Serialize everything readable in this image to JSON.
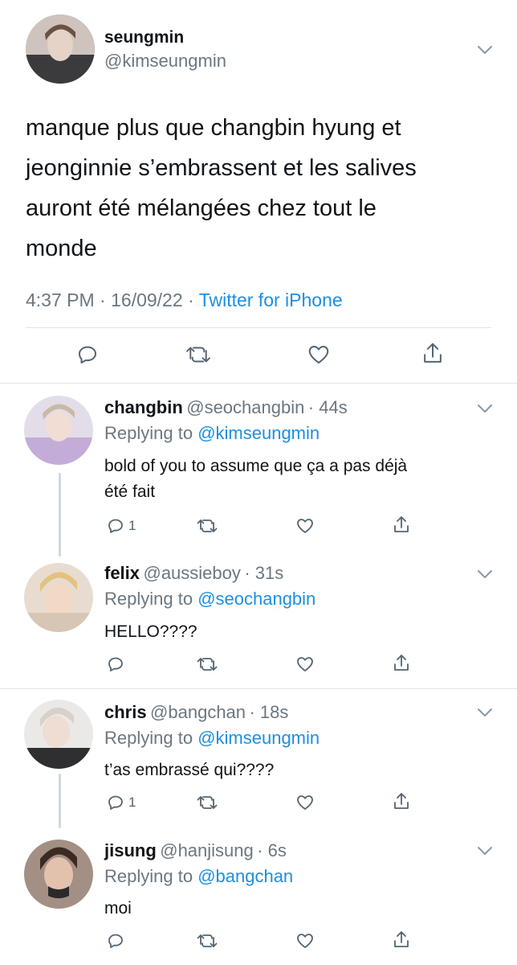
{
  "main_tweet": {
    "display_name": "seungmin",
    "handle": "@kimseungmin",
    "text_lines": [
      "manque plus que changbin hyung et",
      "jeonginnie s’embrassent et les salives",
      "auront été mélangées chez tout le",
      "monde"
    ],
    "time": "4:37 PM",
    "date": "16/09/22",
    "sep": "·",
    "source": "Twitter for iPhone",
    "avatar_color": "#b9a9a0"
  },
  "replies": [
    {
      "display_name": "changbin",
      "handle": "@seochangbin",
      "age": "· 44s",
      "replying_prefix": "Replying to ",
      "replying_to": "@kimseungmin",
      "text_lines": [
        "bold of you to assume que ça a pas déjà",
        "été fait"
      ],
      "reply_count": "1",
      "avatar_color": "#c7b1d9"
    },
    {
      "display_name": "felix",
      "handle": "@aussieboy",
      "age": "· 31s",
      "replying_prefix": "Replying to ",
      "replying_to": "@seochangbin",
      "text_lines": [
        "HELLO????"
      ],
      "reply_count": "",
      "avatar_color": "#e9c79d"
    },
    {
      "display_name": "chris",
      "handle": "@bangchan",
      "age": "· 18s",
      "replying_prefix": "Replying to ",
      "replying_to": "@kimseungmin",
      "text_lines": [
        "t’as embrassé qui????"
      ],
      "reply_count": "1",
      "avatar_color": "#d9d6d3"
    },
    {
      "display_name": "jisung",
      "handle": "@hanjisung",
      "age": "· 6s",
      "replying_prefix": "Replying to ",
      "replying_to": "@bangchan",
      "text_lines": [
        "moi"
      ],
      "reply_count": "",
      "avatar_color": "#8c7565"
    }
  ],
  "colors": {
    "link": "#1d8fe0",
    "muted": "#6b7780",
    "divider": "#dde3e7"
  },
  "icons": [
    "reply-icon",
    "retweet-icon",
    "like-icon",
    "share-icon",
    "chevron-down-icon"
  ]
}
